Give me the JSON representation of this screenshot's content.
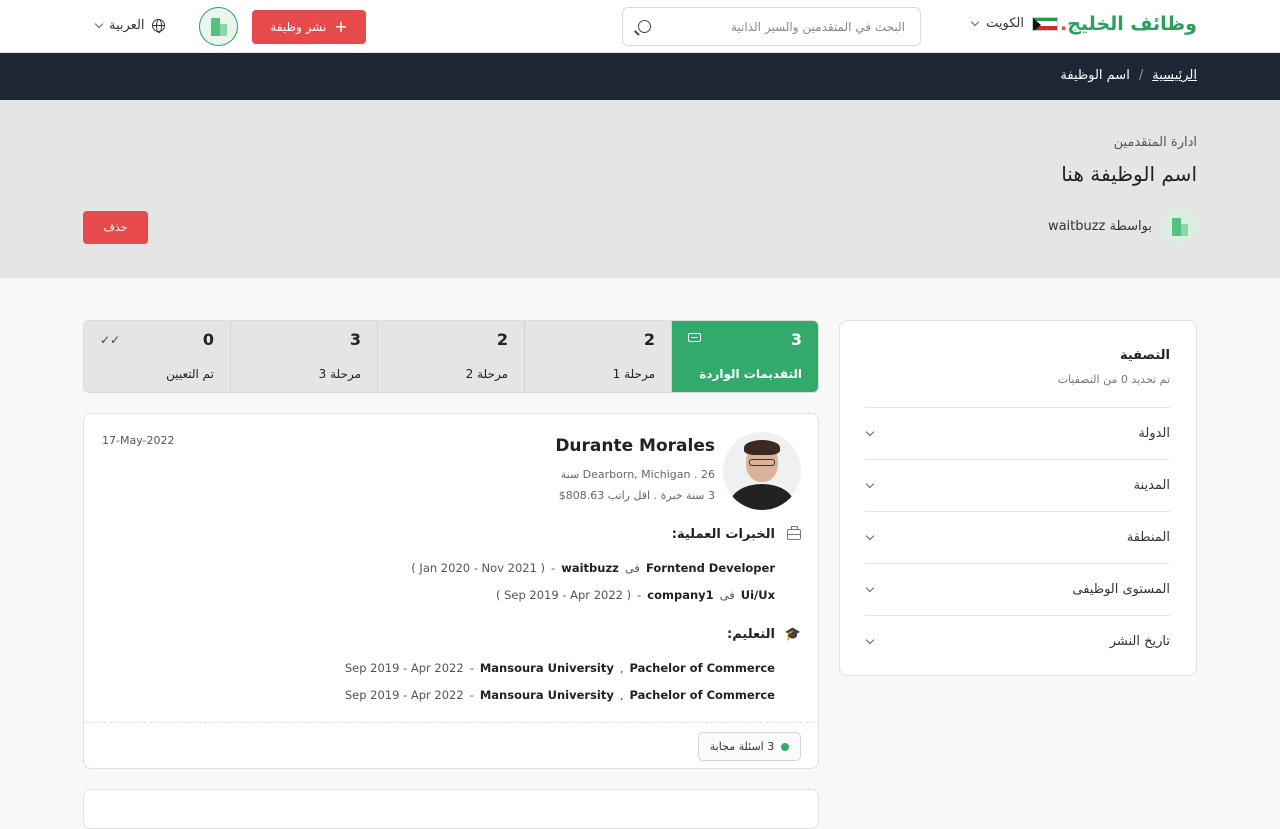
{
  "header": {
    "logo": "وظائف الخليج",
    "logo_dot": ".",
    "country": "الكويت",
    "search_placeholder": "البحث في المتقدمين والسير الذاتية",
    "post_job": "نشر وظيفة",
    "language": "العربية"
  },
  "breadcrumb": {
    "home": "الرئيسية",
    "separator": "/",
    "current": "اسم الوظيفة"
  },
  "hero": {
    "subtitle": "ادارة المتقدمين",
    "title": "اسم الوظيفة هنا",
    "by_label": "بواسطة waitbuzz",
    "delete": "حذف"
  },
  "filter": {
    "title": "التصفية",
    "hint": "تم تحديد 0 من التصفيات",
    "facets": [
      "الدولة",
      "المدينة",
      "المنطقة",
      "المستوى الوظيفى",
      "تاريخ النشر"
    ]
  },
  "stages": [
    {
      "count": "3",
      "label": "التقديمات الواردة",
      "active": true
    },
    {
      "count": "2",
      "label": "مرحلة 1"
    },
    {
      "count": "2",
      "label": "مرحلة 2"
    },
    {
      "count": "3",
      "label": "مرحلة 3"
    },
    {
      "count": "0",
      "label": "تم التعيين"
    }
  ],
  "applicant": {
    "date": "17-May-2022",
    "name": "Durante Morales",
    "location": "Dearborn, Michigan",
    "age": "26 سنة",
    "experience": "3 سنة خبرة",
    "min_salary": "اقل راتب 808.63$",
    "experience_title": "الخبرات العملية:",
    "jobs": [
      {
        "role": "Forntend Developer",
        "at": "فى",
        "company": "waitbuzz",
        "period": "( Jan 2020 - Nov 2021 )"
      },
      {
        "role": "Ui/Ux",
        "at": "فى",
        "company": "company1",
        "period": "( Sep 2019 - Apr 2022 )"
      }
    ],
    "education_title": "التعليم:",
    "education": [
      {
        "degree": "Pachelor of Commerce",
        "school": "Mansoura University",
        "period": "Sep 2019 - Apr 2022"
      },
      {
        "degree": "Pachelor of Commerce",
        "school": "Mansoura University",
        "period": "Sep 2019 - Apr 2022"
      }
    ],
    "answered": "3 اسئلة مجابة"
  },
  "colors": {
    "brand_green": "#33a96b",
    "danger": "#e64a4a",
    "dark_bar": "#1f2633"
  }
}
